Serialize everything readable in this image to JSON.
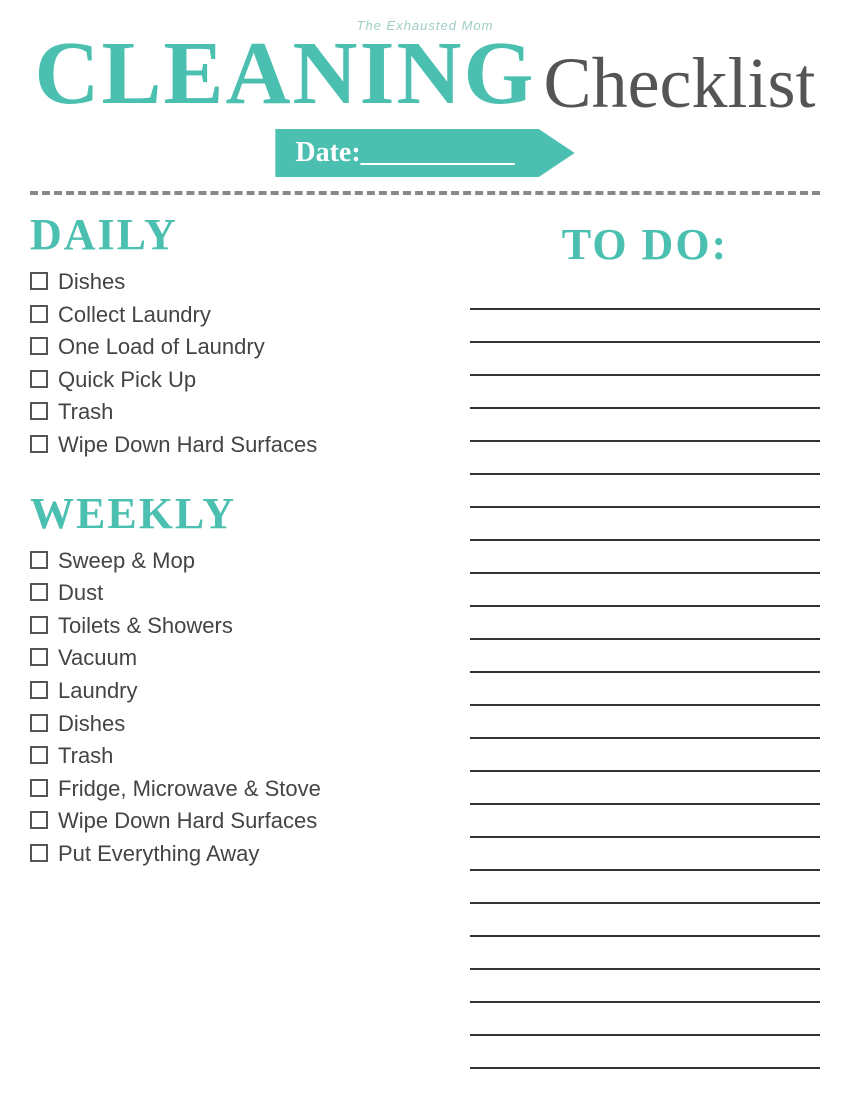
{
  "header": {
    "subtitle": "The Exhausted Mom",
    "cleaning": "Cleaning",
    "checklist": "Checklist",
    "date_label": "Date:___________"
  },
  "daily": {
    "heading": "Daily",
    "items": [
      "Dishes",
      "Collect Laundry",
      "One Load of Laundry",
      "Quick Pick Up",
      "Trash",
      "Wipe Down Hard Surfaces"
    ]
  },
  "weekly": {
    "heading": "Weekly",
    "items": [
      "Sweep & Mop",
      "Dust",
      "Toilets & Showers",
      "Vacuum",
      "Laundry",
      "Dishes",
      "Trash",
      "Fridge, Microwave & Stove",
      "Wipe Down Hard Surfaces",
      "Put Everything Away"
    ]
  },
  "todo": {
    "heading": "To Do:",
    "line_count": 24
  }
}
